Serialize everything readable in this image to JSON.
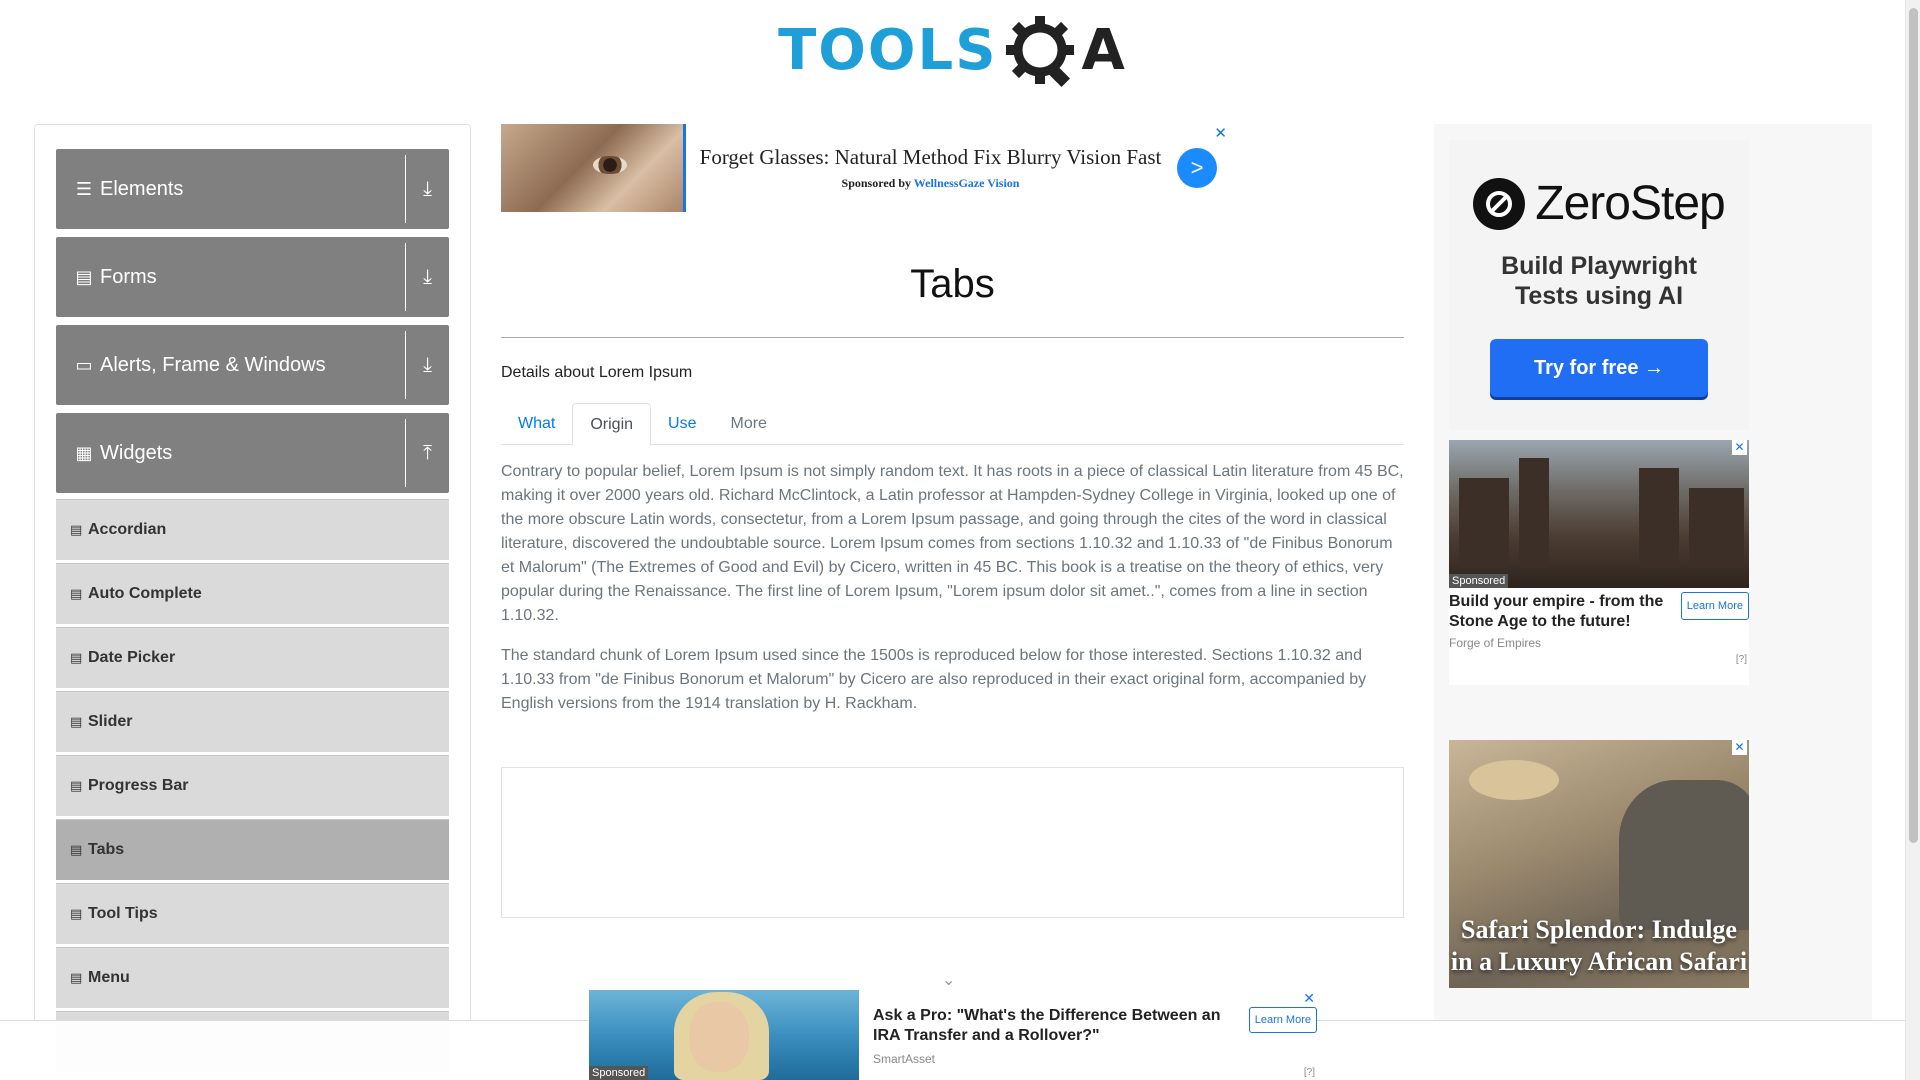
{
  "header": {
    "logo_tools": "TOOLS",
    "logo_q": "Q",
    "logo_a": "A"
  },
  "sidebar": {
    "groups": [
      {
        "label": "Elements",
        "icon": "hamburger-icon",
        "toggle": "download-icon"
      },
      {
        "label": "Forms",
        "icon": "form-icon",
        "toggle": "download-icon"
      },
      {
        "label": "Alerts, Frame & Windows",
        "icon": "window-icon",
        "toggle": "download-icon"
      },
      {
        "label": "Widgets",
        "icon": "widgets-icon",
        "toggle": "upload-icon"
      }
    ],
    "items": [
      {
        "label": "Accordian"
      },
      {
        "label": "Auto Complete"
      },
      {
        "label": "Date Picker"
      },
      {
        "label": "Slider"
      },
      {
        "label": "Progress Bar"
      },
      {
        "label": "Tabs"
      },
      {
        "label": "Tool Tips"
      },
      {
        "label": "Menu"
      }
    ],
    "active_item": "Tabs"
  },
  "top_ad": {
    "headline": "Forget Glasses: Natural Method Fix Blurry Vision Fast",
    "sponsored_by": "Sponsored by ",
    "sponsor_name": "WellnessGaze Vision",
    "go": ">",
    "close": "✕"
  },
  "main": {
    "title": "Tabs",
    "details": "Details about Lorem Ipsum",
    "tabs": [
      {
        "label": "What"
      },
      {
        "label": "Origin"
      },
      {
        "label": "Use"
      },
      {
        "label": "More"
      }
    ],
    "active_tab": "Origin",
    "paragraphs": [
      "Contrary to popular belief, Lorem Ipsum is not simply random text. It has roots in a piece of classical Latin literature from 45 BC, making it over 2000 years old. Richard McClintock, a Latin professor at Hampden-Sydney College in Virginia, looked up one of the more obscure Latin words, consectetur, from a Lorem Ipsum passage, and going through the cites of the word in classical literature, discovered the undoubtable source. Lorem Ipsum comes from sections 1.10.32 and 1.10.33 of \"de Finibus Bonorum et Malorum\" (The Extremes of Good and Evil) by Cicero, written in 45 BC. This book is a treatise on the theory of ethics, very popular during the Renaissance. The first line of Lorem Ipsum, \"Lorem ipsum dolor sit amet..\", comes from a line in section 1.10.32.",
      "The standard chunk of Lorem Ipsum used since the 1500s is reproduced below for those interested. Sections 1.10.32 and 1.10.33 from \"de Finibus Bonorum et Malorum\" by Cicero are also reproduced in their exact original form, accompanied by English versions from the 1914 translation by H. Rackham."
    ],
    "chevron": "⌄"
  },
  "right_ads": {
    "zerostep": {
      "brand": "ZeroStep",
      "tagline_1": "Build Playwright",
      "tagline_2": "Tests using AI",
      "button": "Try for free →"
    },
    "empire": {
      "sponsored": "Sponsored",
      "headline": "Build your empire - from the Stone Age to the future!",
      "button": "Learn More",
      "brand": "Forge of Empires",
      "adchoice": "[?]",
      "close": "✕"
    },
    "safari": {
      "headline": "Safari Splendor: Indulge in a Luxury African Safari",
      "close": "✕"
    }
  },
  "bottom_ad": {
    "sponsored": "Sponsored",
    "headline": "Ask a Pro: \"What's the Difference Between an IRA Transfer and a Rollover?\"",
    "brand": "SmartAsset",
    "button": "Learn More",
    "adchoice": "[?]",
    "close": "✕"
  },
  "colors": {
    "brand_blue": "#1e9fd8",
    "sidebar_header": "#808080",
    "menu_item": "#dadada",
    "menu_item_active": "#b0b0b0",
    "link_blue": "#007bff"
  }
}
